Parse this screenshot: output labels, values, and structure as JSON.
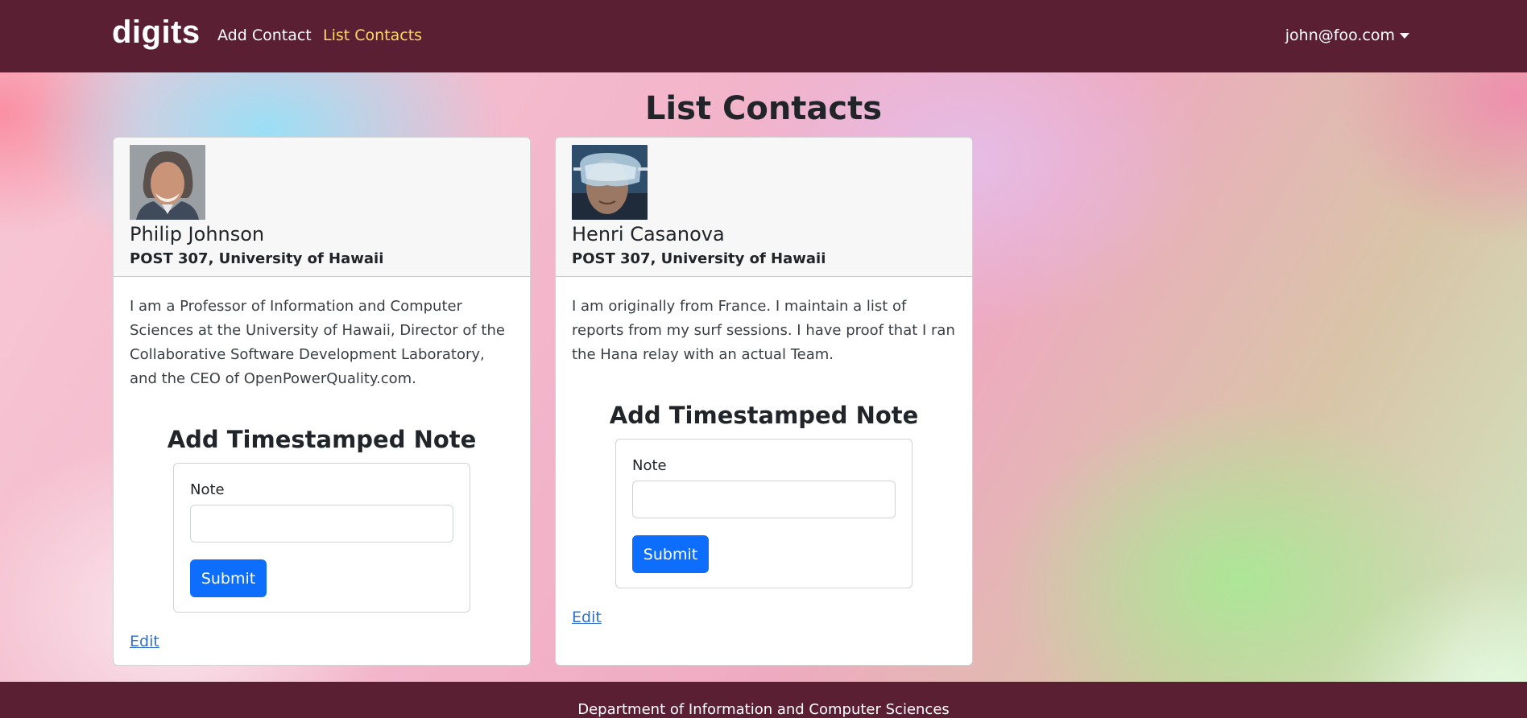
{
  "navbar": {
    "brand": "digits",
    "links": [
      {
        "label": "Add Contact",
        "active": false
      },
      {
        "label": "List Contacts",
        "active": true
      }
    ],
    "user": "john@foo.com"
  },
  "page": {
    "title": "List Contacts"
  },
  "contacts": [
    {
      "name": "Philip Johnson",
      "address": "POST 307, University of Hawaii",
      "description": "I am a Professor of Information and Computer Sciences at the University of Hawaii, Director of the Collaborative Software Development Laboratory, and the CEO of OpenPowerQuality.com.",
      "note_title": "Add Timestamped Note",
      "note_label": "Note",
      "note_value": "",
      "submit_label": "Submit",
      "edit_label": "Edit"
    },
    {
      "name": "Henri Casanova",
      "address": "POST 307, University of Hawaii",
      "description": "I am originally from France. I maintain a list of reports from my surf sessions. I have proof that I ran the Hana relay with an actual Team.",
      "note_title": "Add Timestamped Note",
      "note_label": "Note",
      "note_value": "",
      "submit_label": "Submit",
      "edit_label": "Edit"
    }
  ],
  "footer": {
    "text": "Department of Information and Computer Sciences"
  },
  "colors": {
    "navbar_bg": "#5b1f33",
    "active_link": "#ffd966",
    "primary_button": "#0d6efd",
    "link": "#2f6fc9"
  }
}
